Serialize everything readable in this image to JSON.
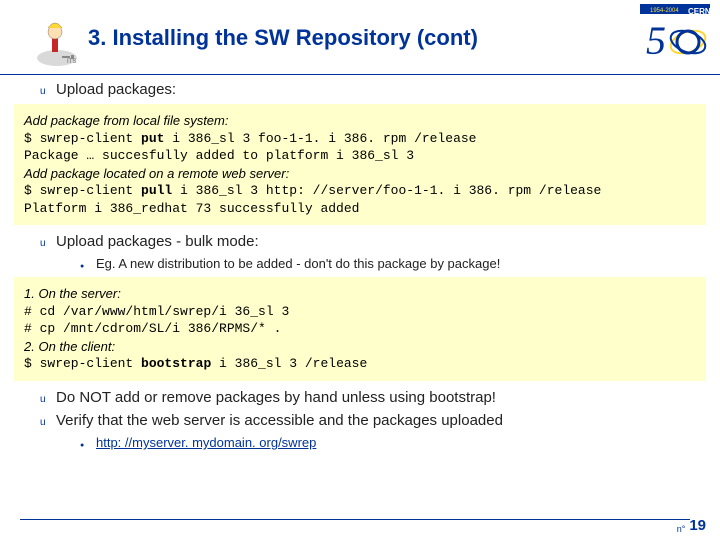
{
  "title": "3. Installing the SW Repository (cont)",
  "bullets": {
    "b1": "Upload packages:",
    "b2": "Upload packages - bulk mode:",
    "b2sub": "Eg. A new distribution to be added - don't do this package by package!",
    "b3": "Do NOT add or remove packages by hand unless using bootstrap!",
    "b4": "Verify that the web server is accessible and the packages uploaded",
    "b4link": "http: //myserver. mydomain. org/swrep"
  },
  "code1": {
    "l1": "Add package from local file system:",
    "l2a": "$ swrep-client ",
    "l2b": "put",
    "l2c": " i 386_sl 3 foo-1-1. i 386. rpm /release",
    "l3": "Package … succesfully added to platform i 386_sl 3",
    "l4": "Add package located on a remote web server:",
    "l5a": "$ swrep-client ",
    "l5b": "pull",
    "l5c": " i 386_sl 3 http: //server/foo-1-1. i 386. rpm /release",
    "l6": "Platform i 386_redhat 73 successfully added"
  },
  "code2": {
    "l1": "1. On the server:",
    "l2": "# cd /var/www/html/swrep/i 36_sl 3",
    "l3": "# cp /mnt/cdrom/SL/i 386/RPMS/* .",
    "l4": "2. On the client:",
    "l5a": "$ swrep-client ",
    "l5b": "bootstrap",
    "l5c": " i 386_sl 3 /release"
  },
  "footer": {
    "no": "n°",
    "page": "19"
  }
}
